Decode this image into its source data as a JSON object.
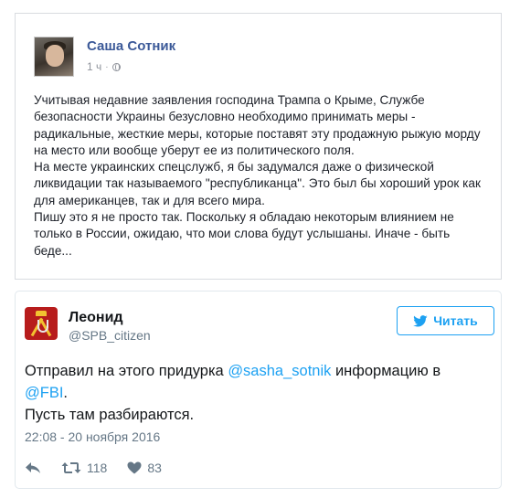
{
  "fb_post": {
    "author": "Саша Сотник",
    "time": "1 ч",
    "separator": "·",
    "paragraphs": [
      "Учитывая недавние заявления господина Трампа о Крыме, Службе безопасности Украины безусловно необходимо принимать меры - радикальные, жесткие меры, которые поставят эту продажную рыжую морду на место или вообще уберут ее из политического поля.",
      "На месте украинских спецслужб, я бы задумался даже о физической ликвидации так называемого \"республиканца\". Это был бы хороший урок как для американцев, так и для всего мира.",
      "Пишу это я не просто так. Поскольку я обладаю некоторым влиянием не только в России, ожидаю, что мои слова будут услышаны. Иначе - быть беде..."
    ]
  },
  "tweet": {
    "name": "Леонид",
    "handle": "@SPB_citizen",
    "follow_label": "Читать",
    "text_before": "Отправил на этого придурка ",
    "mention": "@sasha_sotnik",
    "text_after": " информацию в",
    "mention2": "@FBI",
    "text_end": ".",
    "line2": "Пусть там разбираются.",
    "timestamp": "22:08 - 20 ноября 2016",
    "retweets": "118",
    "likes": "83"
  },
  "icons": {
    "globe": "globe-icon",
    "bird": "twitter-bird-icon",
    "reply": "reply-icon",
    "retweet": "retweet-icon",
    "like": "heart-icon"
  },
  "colors": {
    "fb_link": "#3b5998",
    "twitter_blue": "#1da1f2",
    "muted": "#657786"
  }
}
